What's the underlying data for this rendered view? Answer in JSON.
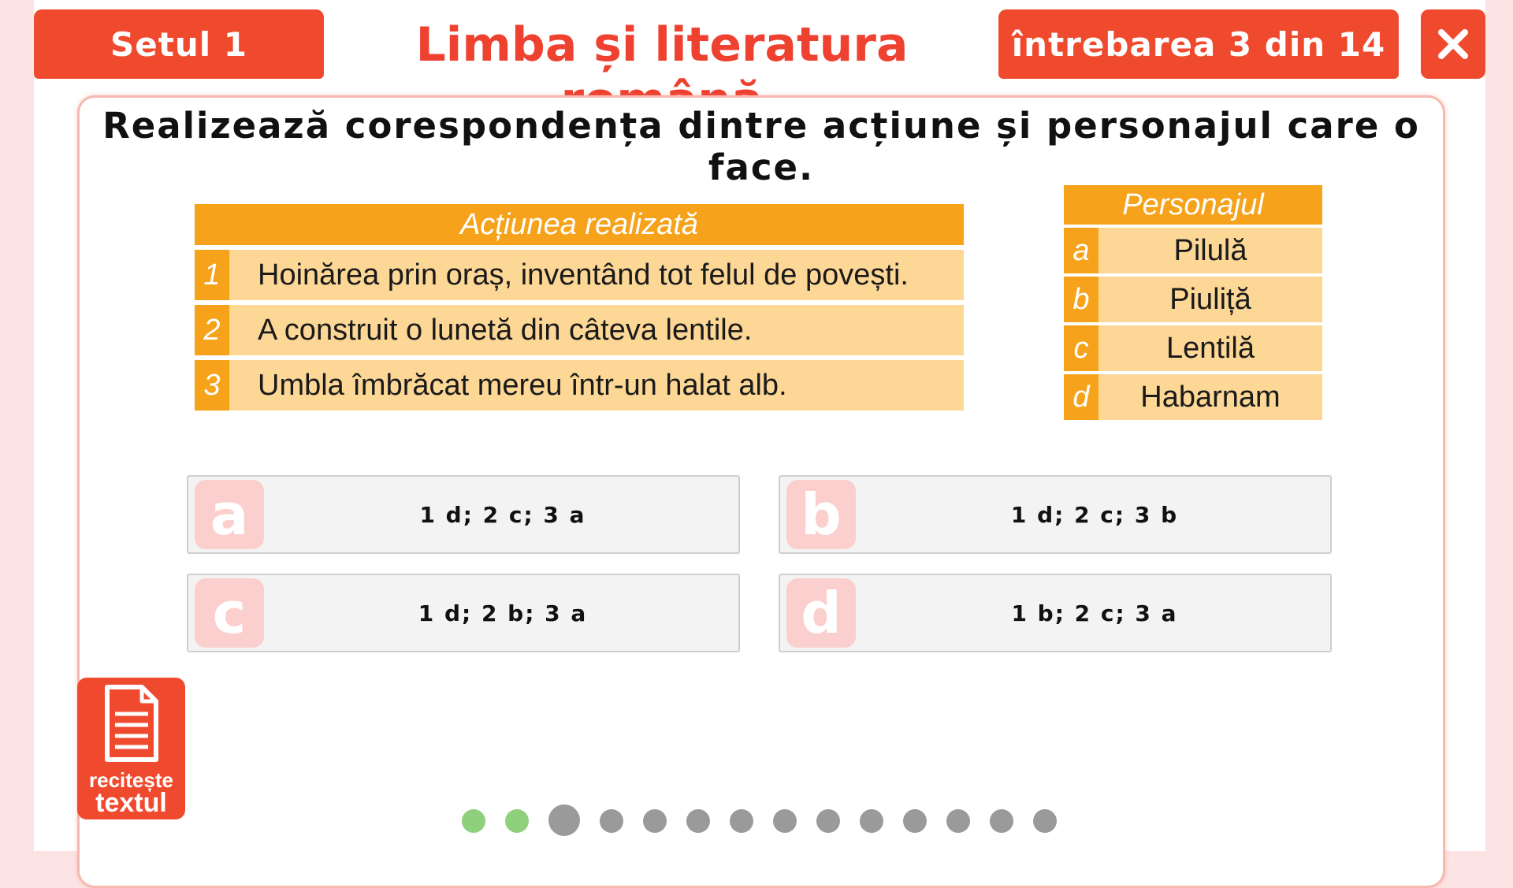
{
  "header": {
    "set_label": "Setul 1",
    "subject_title": "Limba și literatura română",
    "question_counter": "întrebarea 3 din 14",
    "close_icon": "close-icon"
  },
  "question": {
    "text": "Realizează corespondența dintre acțiune și personajul care o face."
  },
  "actions_table": {
    "header": "Acțiunea realizată",
    "rows": [
      {
        "num": "1",
        "text": "Hoinărea prin oraș, inventând tot felul de povești."
      },
      {
        "num": "2",
        "text": "A construit o lunetă din câteva lentile."
      },
      {
        "num": "3",
        "text": "Umbla îmbrăcat mereu într-un halat alb."
      }
    ]
  },
  "characters_table": {
    "header": "Personajul",
    "rows": [
      {
        "letter": "a",
        "name": "Pilulă"
      },
      {
        "letter": "b",
        "name": "Piuliță"
      },
      {
        "letter": "c",
        "name": "Lentilă"
      },
      {
        "letter": "d",
        "name": "Habarnam"
      }
    ]
  },
  "options": [
    {
      "letter": "a",
      "text": "1 d; 2 c; 3 a"
    },
    {
      "letter": "b",
      "text": "1 d; 2 c; 3 b"
    },
    {
      "letter": "c",
      "text": "1 d; 2 b; 3 a"
    },
    {
      "letter": "d",
      "text": "1 b; 2 c; 3 a"
    }
  ],
  "reread": {
    "line1": "recitește",
    "line2": "textul",
    "icon": "document-icon"
  },
  "progress": {
    "total": 14,
    "current": 3,
    "answered": 2
  },
  "colors": {
    "accent": "#f04a2e",
    "table_header": "#f6a21a",
    "table_row": "#fdd795",
    "done_dot": "#8fd07d",
    "pending_dot": "#9a9a9a"
  }
}
